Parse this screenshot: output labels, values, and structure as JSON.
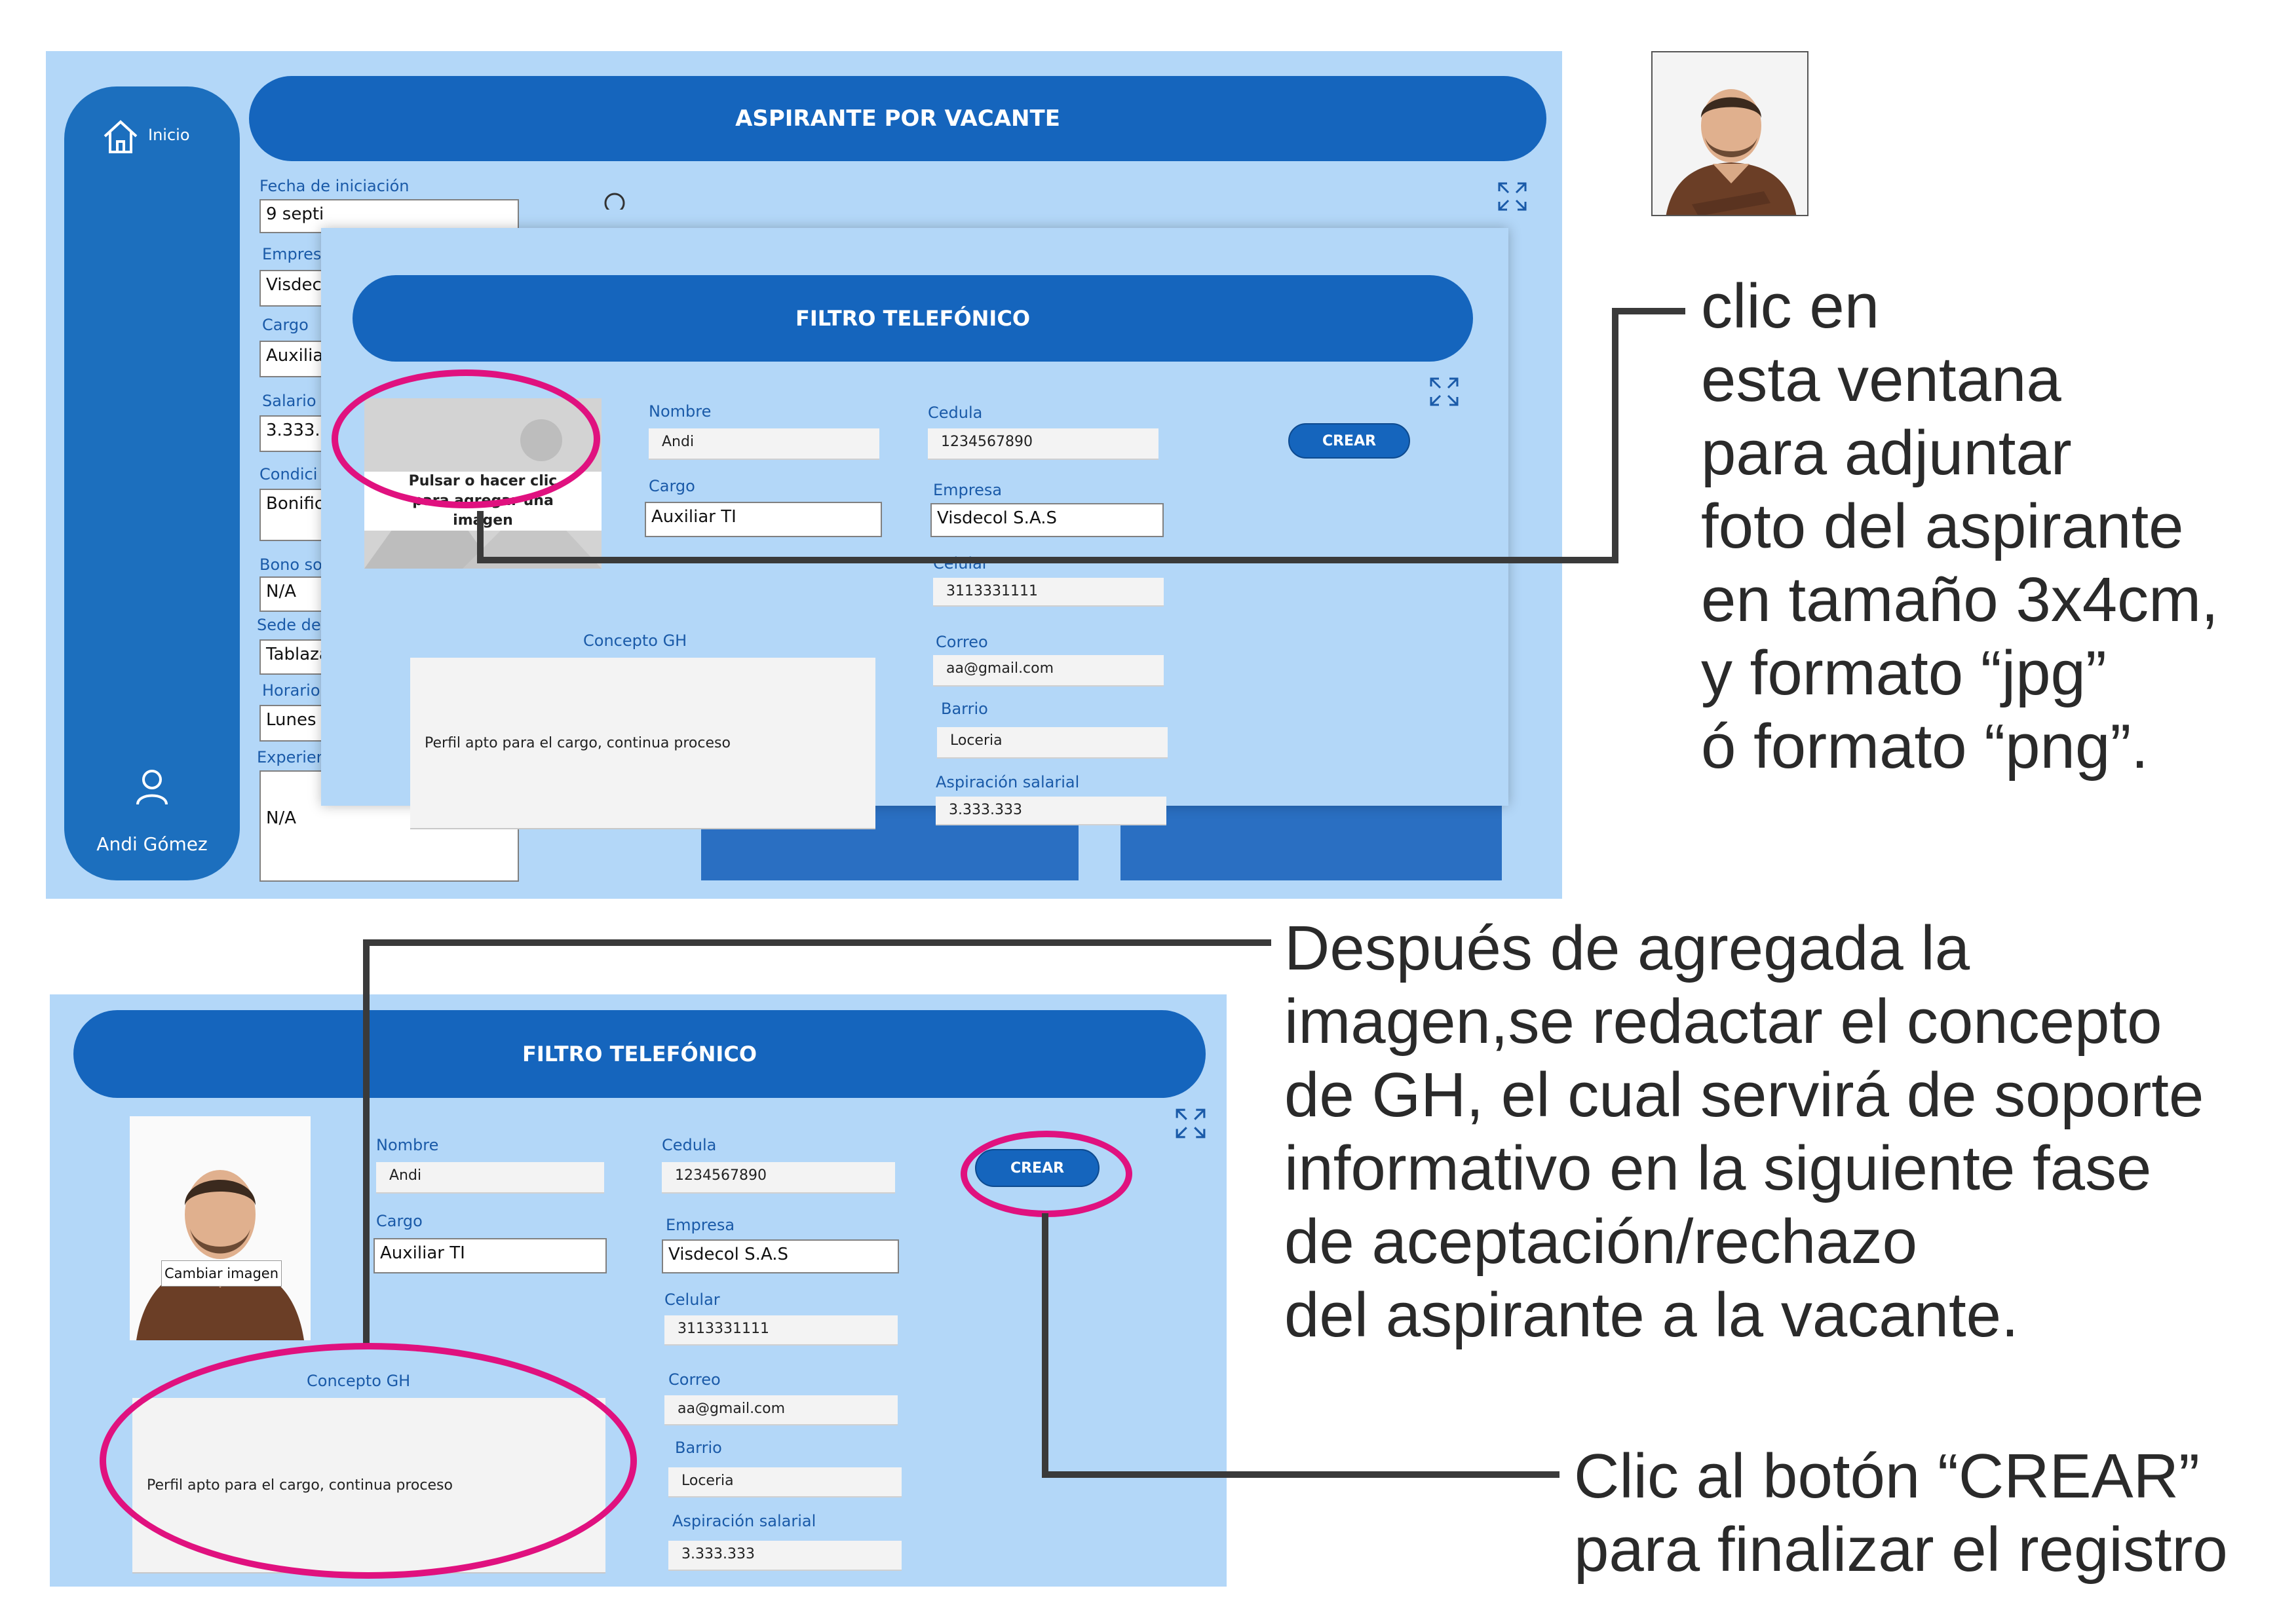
{
  "top_screen": {
    "sidebar": {
      "home_label": "Inicio",
      "user_name": "Andi Gómez"
    },
    "header_title": "ASPIRANTE POR VACANTE",
    "form": {
      "fecha_label": "Fecha de iniciación",
      "fecha_value": "9 septi",
      "empresa_label": "Empres",
      "empresa_value": "Visdec",
      "cargo_label": "Cargo",
      "cargo_value": "Auxilia",
      "salario_label": "Salario",
      "salario_value": "3.333.3",
      "condicion_label": "Condici",
      "condicion_value": "Bonific",
      "bono_label": "Bono so",
      "bono_value": "N/A",
      "sede_label": "Sede de",
      "sede_value": "Tablaza",
      "horario_label": "Horario",
      "horario_value": "Lunes",
      "experiencia_label": "Experien",
      "experiencia_value": "N/A"
    },
    "modal": {
      "title": "FILTRO TELEFÓNICO",
      "image_prompt": "Pulsar o hacer clic para agregar una imagen",
      "nombre_label": "Nombre",
      "nombre_value": "Andi",
      "cedula_label": "Cedula",
      "cedula_value": "1234567890",
      "cargo_label": "Cargo",
      "cargo_value": "Auxiliar TI",
      "empresa_label": "Empresa",
      "empresa_value": "Visdecol S.A.S",
      "celular_label": "Celular",
      "celular_value": "3113331111",
      "correo_label": "Correo",
      "correo_value": "aa@gmail.com",
      "barrio_label": "Barrio",
      "barrio_value": "Loceria",
      "aspiracion_label": "Aspiración salarial",
      "aspiracion_value": "3.333.333",
      "concepto_label": "Concepto GH",
      "concepto_value": "Perfil apto para el cargo, continua proceso",
      "crear_label": "CREAR"
    }
  },
  "bottom_screen": {
    "title": "FILTRO TELEFÓNICO",
    "change_image_label": "Cambiar imagen",
    "nombre_label": "Nombre",
    "nombre_value": "Andi",
    "cedula_label": "Cedula",
    "cedula_value": "1234567890",
    "cargo_label": "Cargo",
    "cargo_value": "Auxiliar TI",
    "empresa_label": "Empresa",
    "empresa_value": "Visdecol S.A.S",
    "celular_label": "Celular",
    "celular_value": "3113331111",
    "correo_label": "Correo",
    "correo_value": "aa@gmail.com",
    "barrio_label": "Barrio",
    "barrio_value": "Loceria",
    "aspiracion_label": "Aspiración salarial",
    "aspiracion_value": "3.333.333",
    "concepto_label": "Concepto GH",
    "concepto_value": "Perfil apto para el cargo, continua proceso",
    "crear_label": "CREAR"
  },
  "annotations": {
    "note1": [
      "clic en",
      "esta ventana",
      "para adjuntar",
      "foto del aspirante",
      "en tamaño 3x4cm,",
      "y formato “jpg”",
      "ó formato “png”."
    ],
    "note2": [
      "Después de agregada la",
      "imagen,se redactar el concepto",
      "de GH, el cual servirá de soporte",
      "informativo en la siguiente fase",
      "de aceptación/rechazo",
      "del aspirante a la vacante."
    ],
    "note3": [
      "Clic al botón “CREAR”",
      "para finalizar el registro"
    ]
  },
  "colors": {
    "panel_bg": "#b3d7f8",
    "primary_blue": "#1565bd",
    "highlight_magenta": "#e0117f"
  },
  "icons": [
    "home-icon",
    "user-icon",
    "expand-icon",
    "search-icon",
    "image-placeholder-icon"
  ]
}
